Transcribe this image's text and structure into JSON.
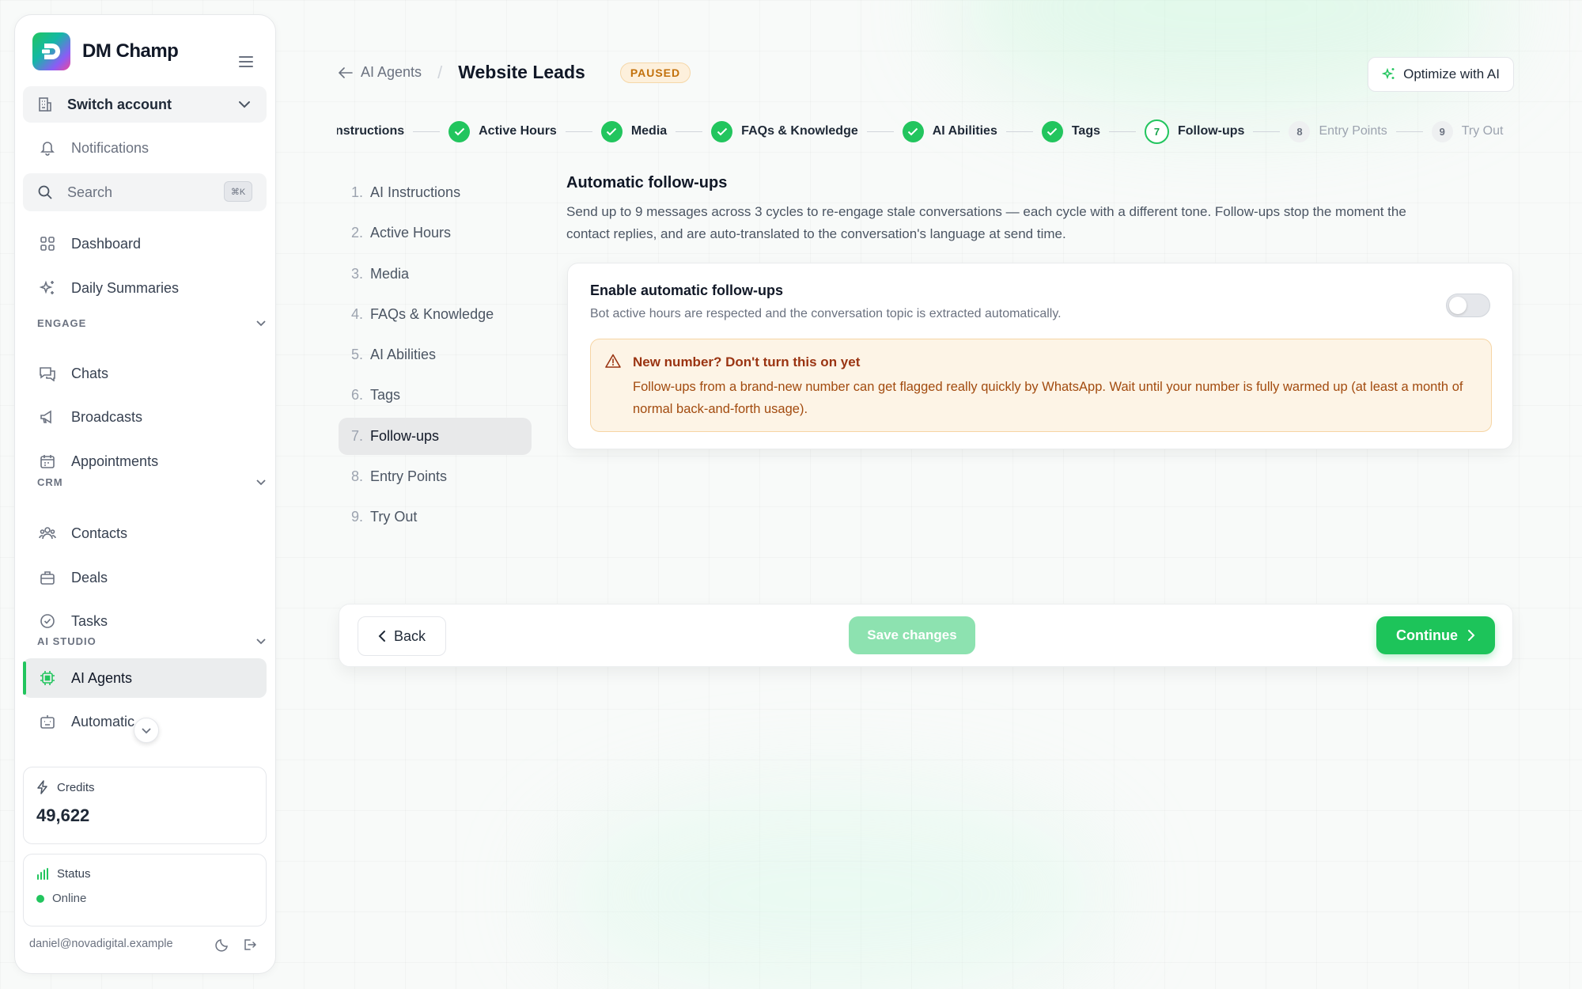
{
  "sidebar": {
    "brand": "DM Champ",
    "switch_account": "Switch account",
    "notifications": "Notifications",
    "search": "Search",
    "search_shortcut": "⌘K",
    "dashboard": "Dashboard",
    "daily_summaries": "Daily Summaries",
    "section_engage": "ENGAGE",
    "chats": "Chats",
    "broadcasts": "Broadcasts",
    "appointments": "Appointments",
    "section_crm": "CRM",
    "contacts": "Contacts",
    "deals": "Deals",
    "tasks": "Tasks",
    "section_ai_studio": "AI STUDIO",
    "ai_agents": "AI Agents",
    "automations": "Automatic",
    "credits_label": "Credits",
    "credits_value": "49,622",
    "status_label": "Status",
    "status_value": "Online",
    "user_email": "daniel@novadigital.example"
  },
  "header": {
    "breadcrumb_parent": "AI Agents",
    "breadcrumb_sep": "/",
    "title": "Website Leads",
    "status_badge": "PAUSED",
    "optimize_button": "Optimize with AI"
  },
  "stepper": {
    "steps": [
      {
        "label": "nstructions",
        "state": "done-cut"
      },
      {
        "label": "Active Hours",
        "state": "done"
      },
      {
        "label": "Media",
        "state": "done"
      },
      {
        "label": "FAQs & Knowledge",
        "state": "done"
      },
      {
        "label": "AI Abilities",
        "state": "done"
      },
      {
        "label": "Tags",
        "state": "done"
      },
      {
        "num": "7",
        "label": "Follow-ups",
        "state": "current"
      },
      {
        "num": "8",
        "label": "Entry Points",
        "state": "pending"
      },
      {
        "num": "9",
        "label": "Try Out",
        "state": "pending"
      }
    ]
  },
  "steplist": [
    {
      "n": "1.",
      "label": "AI Instructions"
    },
    {
      "n": "2.",
      "label": "Active Hours"
    },
    {
      "n": "3.",
      "label": "Media"
    },
    {
      "n": "4.",
      "label": "FAQs & Knowledge"
    },
    {
      "n": "5.",
      "label": "AI Abilities"
    },
    {
      "n": "6.",
      "label": "Tags"
    },
    {
      "n": "7.",
      "label": "Follow-ups"
    },
    {
      "n": "8.",
      "label": "Entry Points"
    },
    {
      "n": "9.",
      "label": "Try Out"
    }
  ],
  "followups": {
    "title": "Automatic follow-ups",
    "description": "Send up to 9 messages across 3 cycles to re-engage stale conversations — each cycle with a different tone. Follow-ups stop the moment the contact replies, and are auto-translated to the conversation's language at send time.",
    "enable_title": "Enable automatic follow-ups",
    "enable_sub": "Bot active hours are respected and the conversation topic is extracted automatically.",
    "enabled": false,
    "warning_title": "New number? Don't turn this on yet",
    "warning_body": "Follow-ups from a brand-new number can get flagged really quickly by WhatsApp. Wait until your number is fully warmed up (at least a month of normal back-and-forth usage)."
  },
  "actions": {
    "back": "Back",
    "save": "Save changes",
    "continue": "Continue"
  },
  "colors": {
    "accent": "#22c55e",
    "warning_bg": "#fdf4e6",
    "badge_text": "#c2710c"
  }
}
